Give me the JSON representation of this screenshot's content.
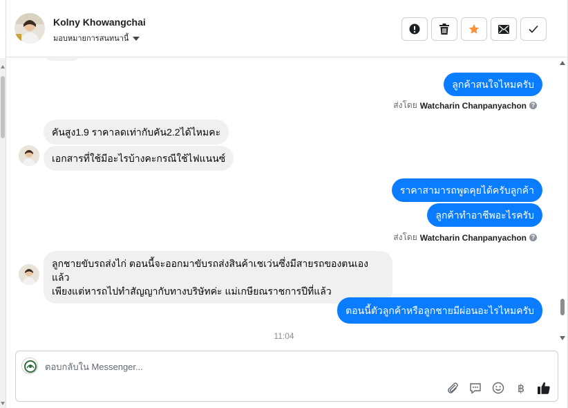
{
  "header": {
    "customer_name": "Kolny Khowangchai",
    "assign_label": "มอบหมายการสนทนานี้"
  },
  "actions": [
    {
      "name": "alert-button",
      "icon": "exclamation-circle-icon"
    },
    {
      "name": "delete-button",
      "icon": "trash-icon"
    },
    {
      "name": "star-button",
      "icon": "star-icon",
      "color": "#f7923a"
    },
    {
      "name": "mail-button",
      "icon": "envelope-icon"
    },
    {
      "name": "done-button",
      "icon": "checkmark-icon"
    }
  ],
  "messages": {
    "out1": "ลูกค้าสนใจไหมครับ",
    "sent_by_label": "ส่งโดย",
    "sent_by_name": "Watcharin Chanpanyachon",
    "in1": "คันสูง1.9 ราคาลดเท่ากับคัน2.2ได้ไหมคะ",
    "in2": "เอกสารที่ใช้มีอะไรบ้างคะกรณีใช้ไฟแนนซ์",
    "out2": "ราคาสามารถพูดคุยได้ครับลูกค้า",
    "out3": "ลูกค้าทำอาชีพอะไรครับ",
    "in3_line1": "ลูกชายขับรถส่งไก่ ตอนนี้จะออกมาขับรถส่งสินค้าเชเว่นซึ่งมีสายรถของตนเองแล้ว",
    "in3_line2": "เพียงแต่หารถไปทำสัญญากับทางบริษัทค่ะ แม่เกษียณราชการปีที่แล้ว",
    "out4": "ตอนนี้ตัวลูกค้าหรือลูกชายมีผ่อนอะไรไหมครับ",
    "time": "11:04"
  },
  "composer": {
    "placeholder": "ตอบกลับใน Messenger..."
  },
  "colors": {
    "outgoing_bubble": "#0a7cff",
    "incoming_bubble": "#f0f0f0",
    "like_icon": "#1c1e21"
  },
  "composer_tools": [
    "paperclip-icon",
    "saved-reply-icon",
    "emoji-icon",
    "baht-icon",
    "thumbs-up-icon"
  ]
}
